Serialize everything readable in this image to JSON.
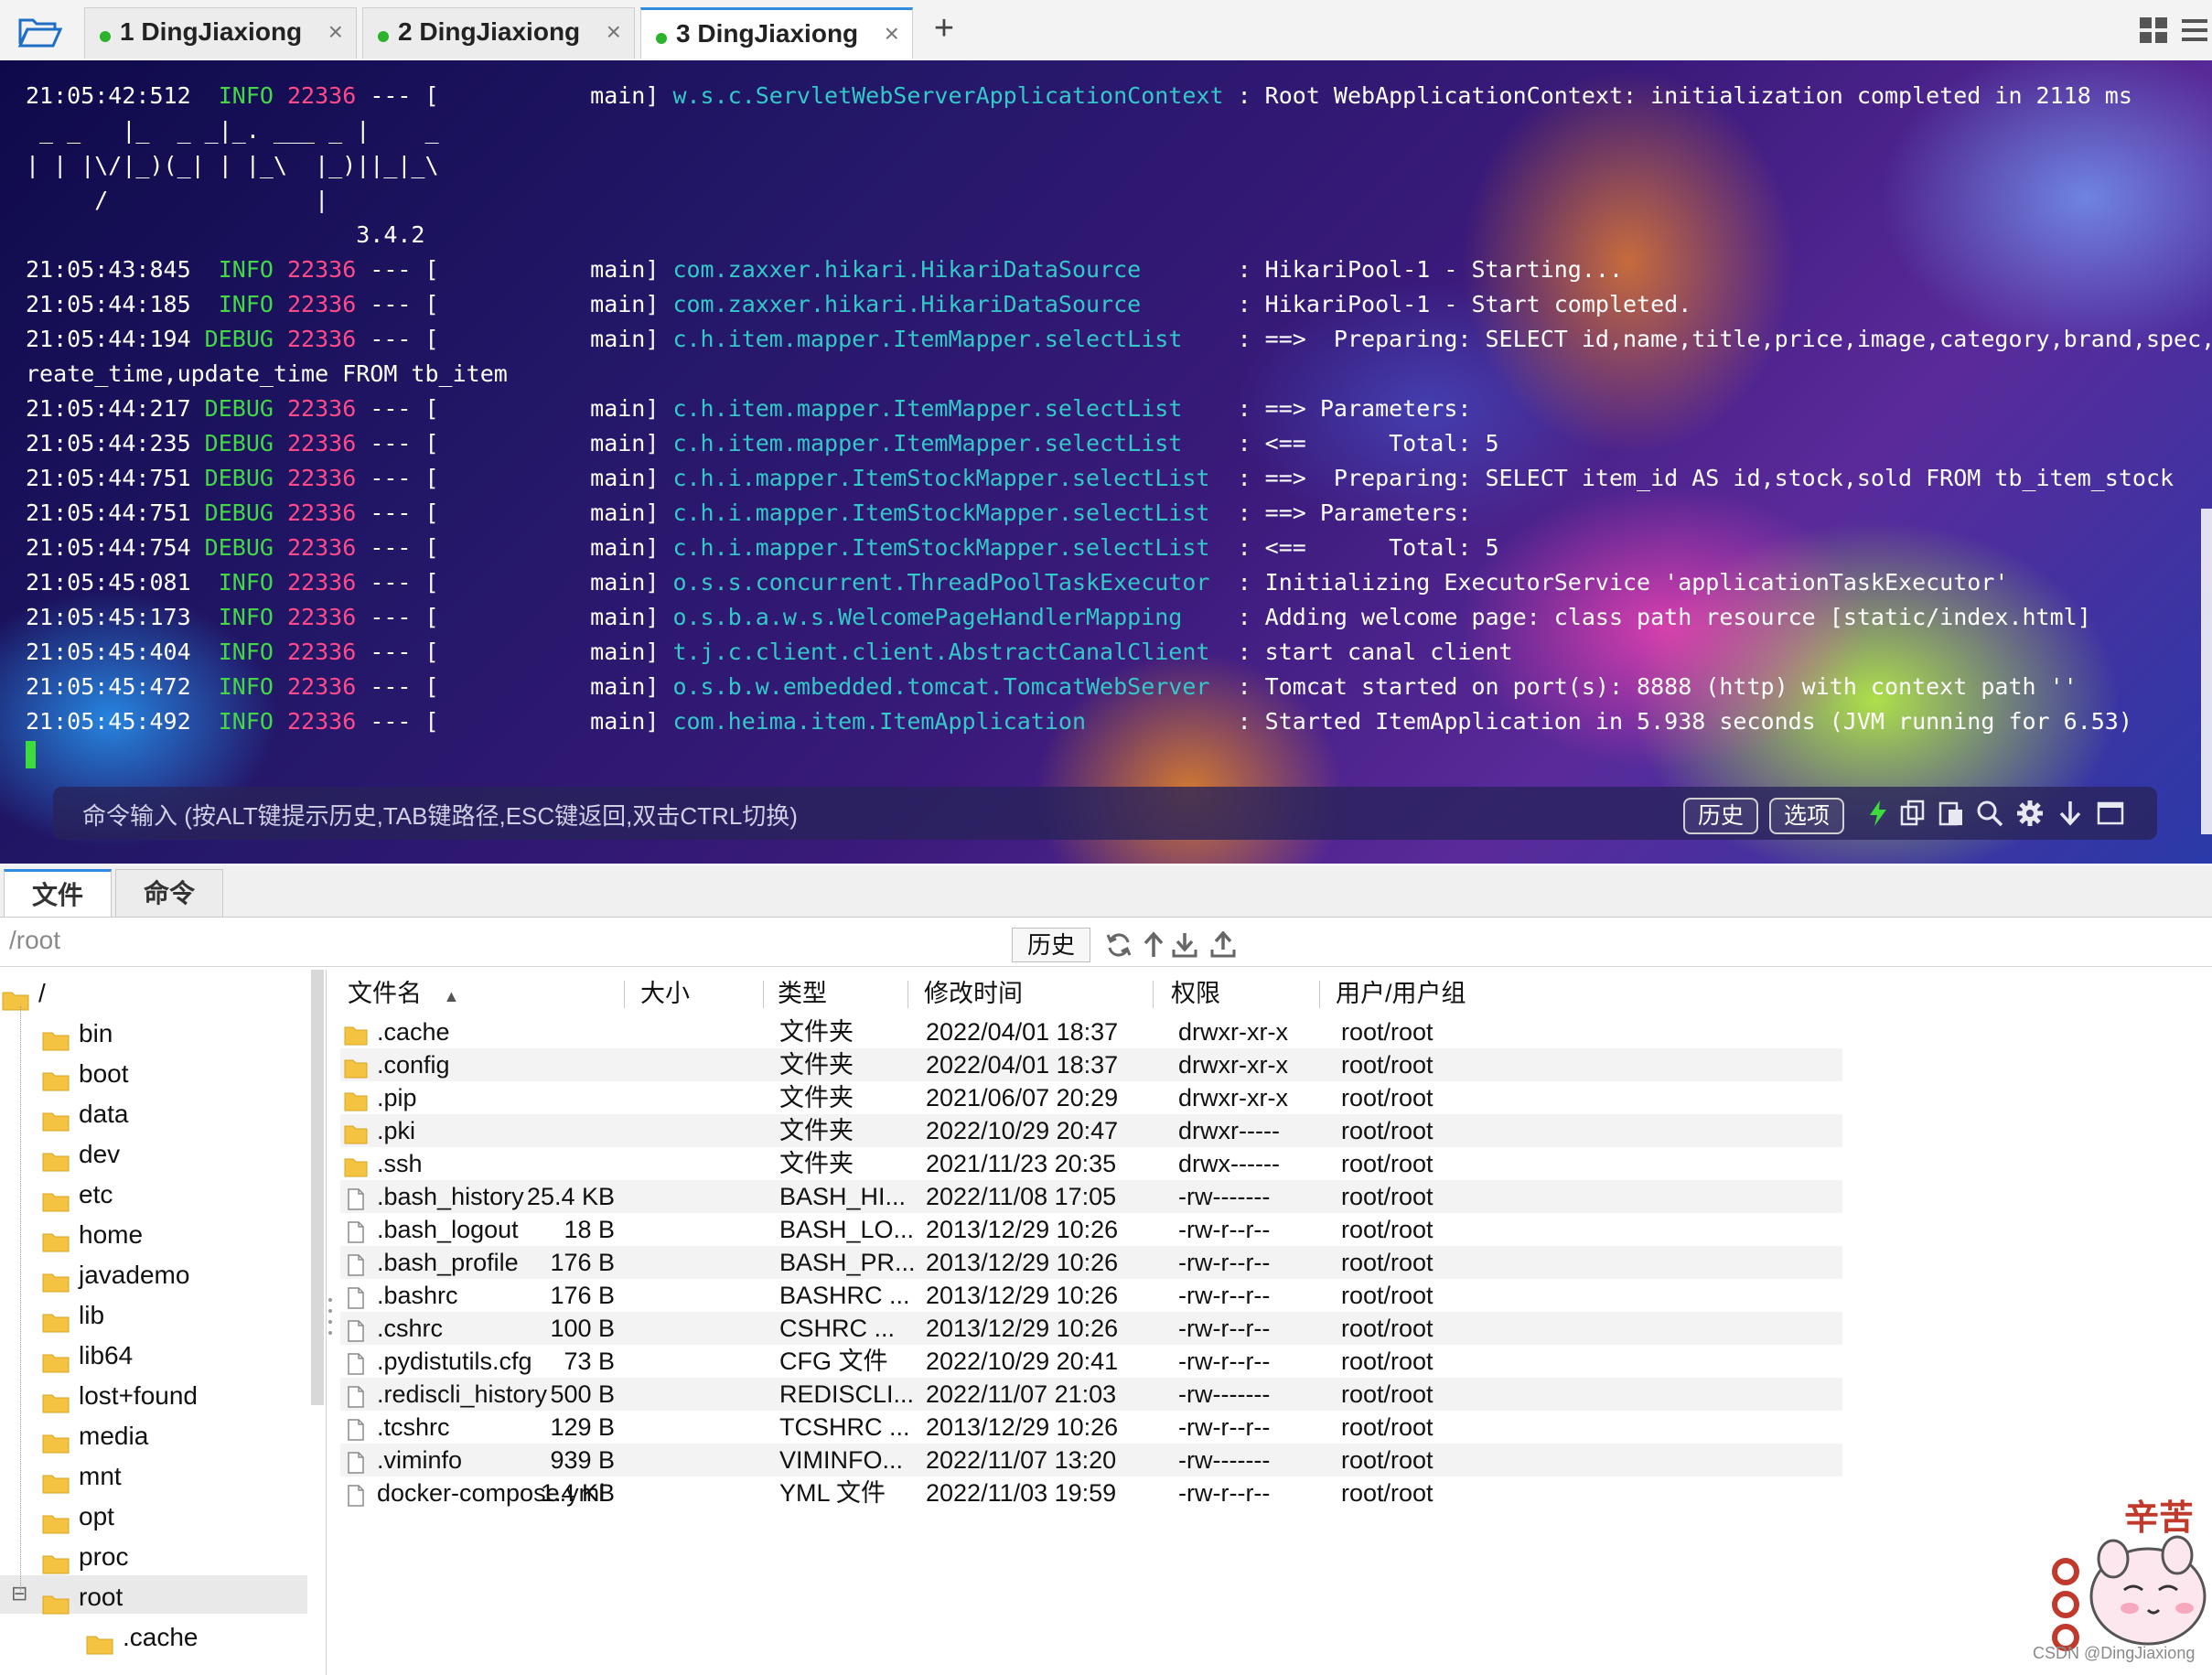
{
  "tabs": [
    {
      "label": "1 DingJiaxiong",
      "close": "×",
      "active": false
    },
    {
      "label": "2 DingJiaxiong",
      "close": "×",
      "active": false
    },
    {
      "label": "3 DingJiaxiong",
      "close": "×",
      "active": true
    }
  ],
  "tab_add": "+",
  "terminal": {
    "lines": [
      [
        {
          "t": "21:05:42:512  ",
          "c": ""
        },
        {
          "t": "INFO",
          "c": "info"
        },
        {
          "t": " ",
          "c": ""
        },
        {
          "t": "22336",
          "c": "pid"
        },
        {
          "t": " --- [           main] ",
          "c": ""
        },
        {
          "t": "w.s.c.ServletWebServerApplicationContext",
          "c": "logger"
        },
        {
          "t": " : Root WebApplicationContext: initialization completed in 2118 ms",
          "c": ""
        }
      ],
      [
        {
          "t": " _ _   |_  _ _|_. ___ _ |    _",
          "c": ""
        }
      ],
      [
        {
          "t": "| | |\\/|_)(_| | |_\\  |_)||_|_\\",
          "c": ""
        }
      ],
      [
        {
          "t": "     /               |",
          "c": ""
        }
      ],
      [
        {
          "t": "                        3.4.2",
          "c": ""
        }
      ],
      [
        {
          "t": "21:05:43:845  ",
          "c": ""
        },
        {
          "t": "INFO",
          "c": "info"
        },
        {
          "t": " ",
          "c": ""
        },
        {
          "t": "22336",
          "c": "pid"
        },
        {
          "t": " --- [           main] ",
          "c": ""
        },
        {
          "t": "com.zaxxer.hikari.HikariDataSource      ",
          "c": "logger"
        },
        {
          "t": " : HikariPool-1 - Starting...",
          "c": ""
        }
      ],
      [
        {
          "t": "21:05:44:185  ",
          "c": ""
        },
        {
          "t": "INFO",
          "c": "info"
        },
        {
          "t": " ",
          "c": ""
        },
        {
          "t": "22336",
          "c": "pid"
        },
        {
          "t": " --- [           main] ",
          "c": ""
        },
        {
          "t": "com.zaxxer.hikari.HikariDataSource      ",
          "c": "logger"
        },
        {
          "t": " : HikariPool-1 - Start completed.",
          "c": ""
        }
      ],
      [
        {
          "t": "21:05:44:194 ",
          "c": ""
        },
        {
          "t": "DEBUG",
          "c": "debug"
        },
        {
          "t": " ",
          "c": ""
        },
        {
          "t": "22336",
          "c": "pid"
        },
        {
          "t": " --- [           main] ",
          "c": ""
        },
        {
          "t": "c.h.item.mapper.ItemMapper.selectList   ",
          "c": "logger"
        },
        {
          "t": " : ==>  Preparing: SELECT id,name,title,price,image,category,brand,spec,status,c",
          "c": ""
        }
      ],
      [
        {
          "t": "reate_time,update_time FROM tb_item",
          "c": ""
        }
      ],
      [
        {
          "t": "21:05:44:217 ",
          "c": ""
        },
        {
          "t": "DEBUG",
          "c": "debug"
        },
        {
          "t": " ",
          "c": ""
        },
        {
          "t": "22336",
          "c": "pid"
        },
        {
          "t": " --- [           main] ",
          "c": ""
        },
        {
          "t": "c.h.item.mapper.ItemMapper.selectList   ",
          "c": "logger"
        },
        {
          "t": " : ==> Parameters: ",
          "c": ""
        }
      ],
      [
        {
          "t": "21:05:44:235 ",
          "c": ""
        },
        {
          "t": "DEBUG",
          "c": "debug"
        },
        {
          "t": " ",
          "c": ""
        },
        {
          "t": "22336",
          "c": "pid"
        },
        {
          "t": " --- [           main] ",
          "c": ""
        },
        {
          "t": "c.h.item.mapper.ItemMapper.selectList   ",
          "c": "logger"
        },
        {
          "t": " : <==      Total: 5",
          "c": ""
        }
      ],
      [
        {
          "t": "21:05:44:751 ",
          "c": ""
        },
        {
          "t": "DEBUG",
          "c": "debug"
        },
        {
          "t": " ",
          "c": ""
        },
        {
          "t": "22336",
          "c": "pid"
        },
        {
          "t": " --- [           main] ",
          "c": ""
        },
        {
          "t": "c.h.i.mapper.ItemStockMapper.selectList ",
          "c": "logger"
        },
        {
          "t": " : ==>  Preparing: SELECT item_id AS id,stock,sold FROM tb_item_stock",
          "c": ""
        }
      ],
      [
        {
          "t": "21:05:44:751 ",
          "c": ""
        },
        {
          "t": "DEBUG",
          "c": "debug"
        },
        {
          "t": " ",
          "c": ""
        },
        {
          "t": "22336",
          "c": "pid"
        },
        {
          "t": " --- [           main] ",
          "c": ""
        },
        {
          "t": "c.h.i.mapper.ItemStockMapper.selectList ",
          "c": "logger"
        },
        {
          "t": " : ==> Parameters: ",
          "c": ""
        }
      ],
      [
        {
          "t": "21:05:44:754 ",
          "c": ""
        },
        {
          "t": "DEBUG",
          "c": "debug"
        },
        {
          "t": " ",
          "c": ""
        },
        {
          "t": "22336",
          "c": "pid"
        },
        {
          "t": " --- [           main] ",
          "c": ""
        },
        {
          "t": "c.h.i.mapper.ItemStockMapper.selectList ",
          "c": "logger"
        },
        {
          "t": " : <==      Total: 5",
          "c": ""
        }
      ],
      [
        {
          "t": "21:05:45:081  ",
          "c": ""
        },
        {
          "t": "INFO",
          "c": "info"
        },
        {
          "t": " ",
          "c": ""
        },
        {
          "t": "22336",
          "c": "pid"
        },
        {
          "t": " --- [           main] ",
          "c": ""
        },
        {
          "t": "o.s.s.concurrent.ThreadPoolTaskExecutor ",
          "c": "logger"
        },
        {
          "t": " : Initializing ExecutorService 'applicationTaskExecutor'",
          "c": ""
        }
      ],
      [
        {
          "t": "21:05:45:173  ",
          "c": ""
        },
        {
          "t": "INFO",
          "c": "info"
        },
        {
          "t": " ",
          "c": ""
        },
        {
          "t": "22336",
          "c": "pid"
        },
        {
          "t": " --- [           main] ",
          "c": ""
        },
        {
          "t": "o.s.b.a.w.s.WelcomePageHandlerMapping   ",
          "c": "logger"
        },
        {
          "t": " : Adding welcome page: class path resource [static/index.html]",
          "c": ""
        }
      ],
      [
        {
          "t": "21:05:45:404  ",
          "c": ""
        },
        {
          "t": "INFO",
          "c": "info"
        },
        {
          "t": " ",
          "c": ""
        },
        {
          "t": "22336",
          "c": "pid"
        },
        {
          "t": " --- [           main] ",
          "c": ""
        },
        {
          "t": "t.j.c.client.client.AbstractCanalClient ",
          "c": "logger"
        },
        {
          "t": " : start canal client",
          "c": ""
        }
      ],
      [
        {
          "t": "21:05:45:472  ",
          "c": ""
        },
        {
          "t": "INFO",
          "c": "info"
        },
        {
          "t": " ",
          "c": ""
        },
        {
          "t": "22336",
          "c": "pid"
        },
        {
          "t": " --- [           main] ",
          "c": ""
        },
        {
          "t": "o.s.b.w.embedded.tomcat.TomcatWebServer ",
          "c": "logger"
        },
        {
          "t": " : Tomcat started on port(s): 8888 (http) with context path ''",
          "c": ""
        }
      ],
      [
        {
          "t": "21:05:45:492  ",
          "c": ""
        },
        {
          "t": "INFO",
          "c": "info"
        },
        {
          "t": " ",
          "c": ""
        },
        {
          "t": "22336",
          "c": "pid"
        },
        {
          "t": " --- [           main] ",
          "c": ""
        },
        {
          "t": "com.heima.item.ItemApplication          ",
          "c": "logger"
        },
        {
          "t": " : Started ItemApplication in 5.938 seconds (JVM running for 6.53)",
          "c": ""
        }
      ]
    ],
    "command_placeholder": "命令输入 (按ALT键提示历史,TAB键路径,ESC键返回,双击CTRL切换)",
    "history_button": "历史",
    "options_button": "选项"
  },
  "file_manager": {
    "tabs": [
      {
        "label": "文件",
        "active": true
      },
      {
        "label": "命令",
        "active": false
      }
    ],
    "path": "/root",
    "history_button": "历史",
    "tree": {
      "root_label": "/",
      "items": [
        "bin",
        "boot",
        "data",
        "dev",
        "etc",
        "home",
        "javademo",
        "lib",
        "lib64",
        "lost+found",
        "media",
        "mnt",
        "opt",
        "proc",
        "root"
      ],
      "child": ".cache",
      "selected": "root",
      "expander": "⊟"
    },
    "columns": [
      "文件名",
      "大小",
      "类型",
      "修改时间",
      "权限",
      "用户/用户组"
    ],
    "sort_indicator": "▲",
    "files": [
      {
        "name": ".cache",
        "size": "",
        "type": "文件夹",
        "modified": "2022/04/01 18:37",
        "perm": "drwxr-xr-x",
        "owner": "root/root",
        "folder": true
      },
      {
        "name": ".config",
        "size": "",
        "type": "文件夹",
        "modified": "2022/04/01 18:37",
        "perm": "drwxr-xr-x",
        "owner": "root/root",
        "folder": true
      },
      {
        "name": ".pip",
        "size": "",
        "type": "文件夹",
        "modified": "2021/06/07 20:29",
        "perm": "drwxr-xr-x",
        "owner": "root/root",
        "folder": true
      },
      {
        "name": ".pki",
        "size": "",
        "type": "文件夹",
        "modified": "2022/10/29 20:47",
        "perm": "drwxr-----",
        "owner": "root/root",
        "folder": true
      },
      {
        "name": ".ssh",
        "size": "",
        "type": "文件夹",
        "modified": "2021/11/23 20:35",
        "perm": "drwx------",
        "owner": "root/root",
        "folder": true
      },
      {
        "name": ".bash_history",
        "size": "25.4 KB",
        "type": "BASH_HI...",
        "modified": "2022/11/08 17:05",
        "perm": "-rw-------",
        "owner": "root/root",
        "folder": false
      },
      {
        "name": ".bash_logout",
        "size": "18 B",
        "type": "BASH_LO...",
        "modified": "2013/12/29 10:26",
        "perm": "-rw-r--r--",
        "owner": "root/root",
        "folder": false
      },
      {
        "name": ".bash_profile",
        "size": "176 B",
        "type": "BASH_PR...",
        "modified": "2013/12/29 10:26",
        "perm": "-rw-r--r--",
        "owner": "root/root",
        "folder": false
      },
      {
        "name": ".bashrc",
        "size": "176 B",
        "type": "BASHRC ...",
        "modified": "2013/12/29 10:26",
        "perm": "-rw-r--r--",
        "owner": "root/root",
        "folder": false
      },
      {
        "name": ".cshrc",
        "size": "100 B",
        "type": "CSHRC ...",
        "modified": "2013/12/29 10:26",
        "perm": "-rw-r--r--",
        "owner": "root/root",
        "folder": false
      },
      {
        "name": ".pydistutils.cfg",
        "size": "73 B",
        "type": "CFG 文件",
        "modified": "2022/10/29 20:41",
        "perm": "-rw-r--r--",
        "owner": "root/root",
        "folder": false
      },
      {
        "name": ".rediscli_history",
        "size": "500 B",
        "type": "REDISCLI...",
        "modified": "2022/11/07 21:03",
        "perm": "-rw-------",
        "owner": "root/root",
        "folder": false
      },
      {
        "name": ".tcshrc",
        "size": "129 B",
        "type": "TCSHRC ...",
        "modified": "2013/12/29 10:26",
        "perm": "-rw-r--r--",
        "owner": "root/root",
        "folder": false
      },
      {
        "name": ".viminfo",
        "size": "939 B",
        "type": "VIMINFO...",
        "modified": "2022/11/07 13:20",
        "perm": "-rw-------",
        "owner": "root/root",
        "folder": false
      },
      {
        "name": "docker-compose.yml",
        "size": "1.4 KB",
        "type": "YML 文件",
        "modified": "2022/11/03 19:59",
        "perm": "-rw-r--r--",
        "owner": "root/root",
        "folder": false
      }
    ]
  },
  "overlay": {
    "sticker_text": "辛苦",
    "watermark": "CSDN @DingJiaxiong"
  },
  "colors": {
    "info_level": "#45d845",
    "pid": "#ff4a8a",
    "logger": "#33c9c9",
    "active_tab_accent": "#2f8ce0",
    "tab_status_dot": "#2bb32b",
    "folder": "#f5c342"
  },
  "icons": [
    "folder-open-icon",
    "add-tab-icon",
    "layout-grid-icon",
    "menu-icon",
    "lightning-icon",
    "copy-icon",
    "paste-icon",
    "search-icon",
    "gear-icon",
    "download-icon",
    "window-icon",
    "refresh-icon",
    "up-directory-icon",
    "download-file-icon",
    "upload-file-icon",
    "folder-icon",
    "file-icon"
  ]
}
